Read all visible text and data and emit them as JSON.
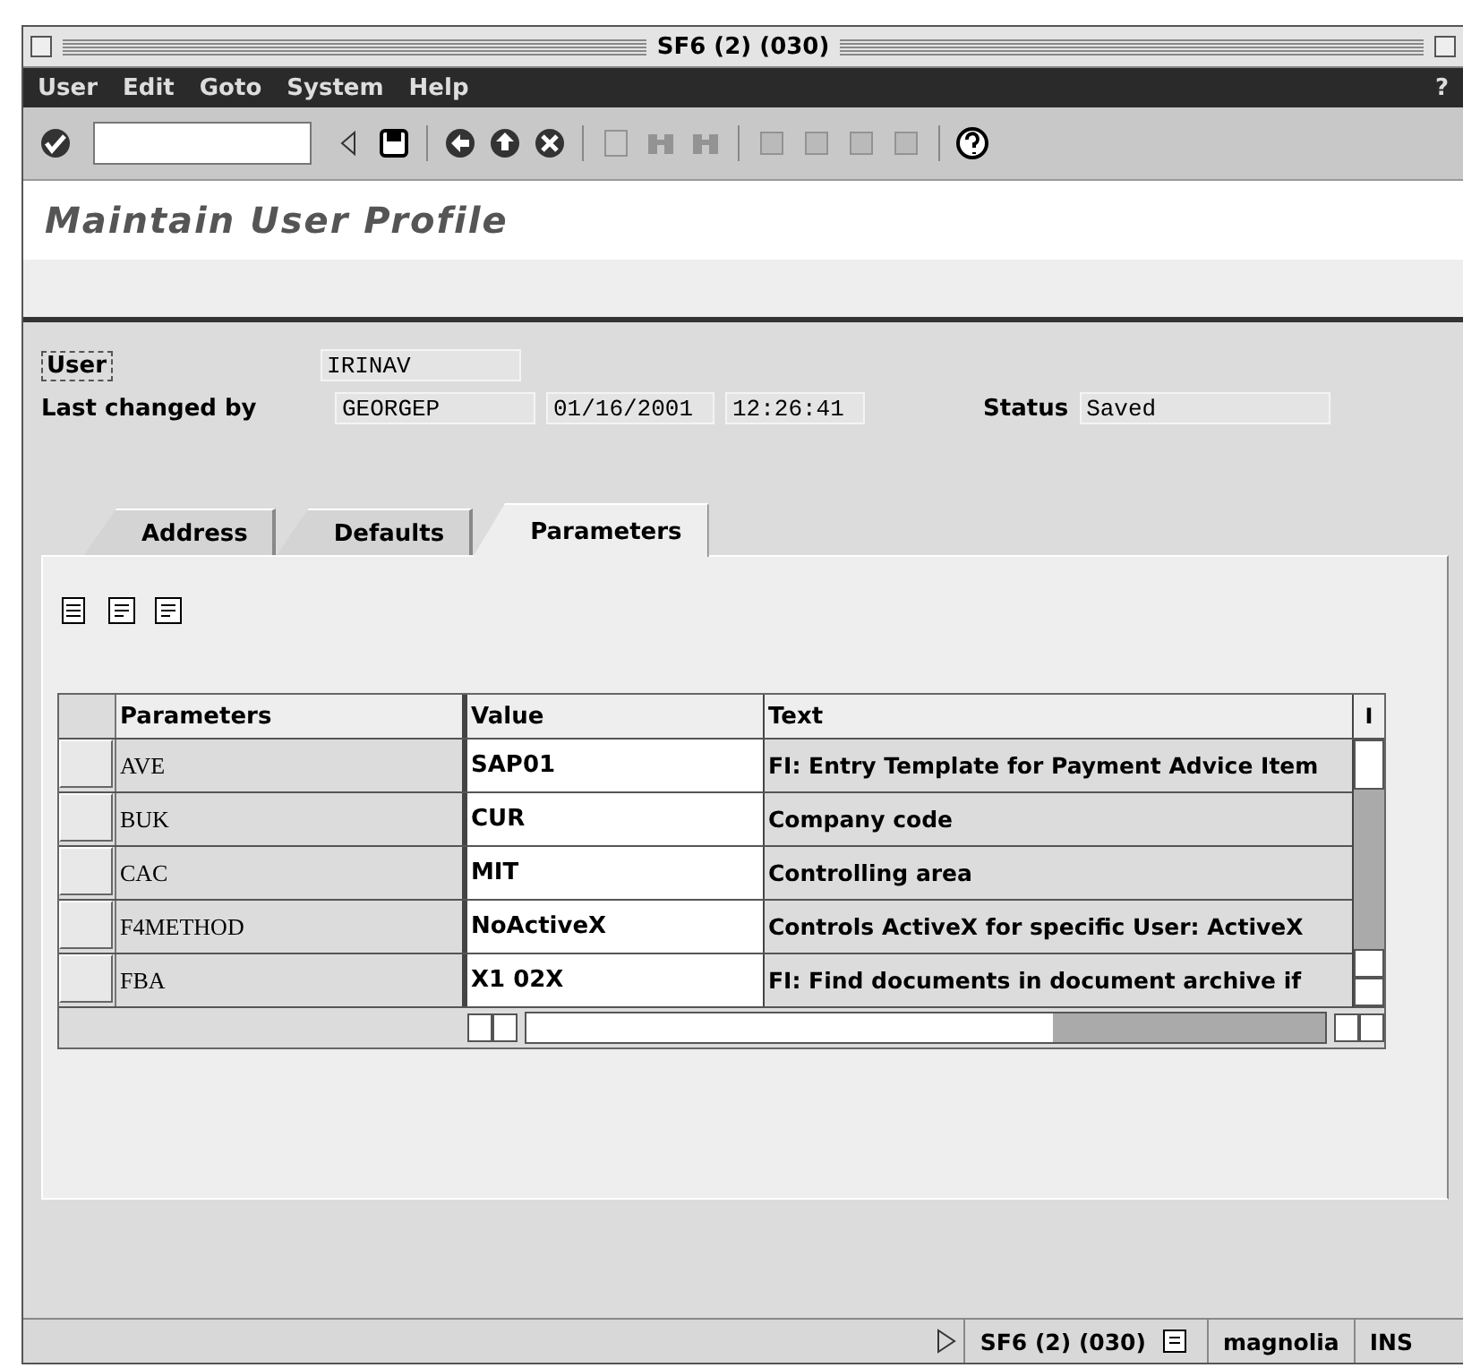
{
  "window": {
    "title": "SF6 (2) (030)"
  },
  "menu": [
    "User",
    "Edit",
    "Goto",
    "System",
    "Help"
  ],
  "menu_help": "?",
  "header": {
    "title": "Maintain User Profile"
  },
  "form": {
    "user_label": "User",
    "user_value": "IRINAV",
    "changed_label": "Last changed by",
    "changed_by": "GEORGEP",
    "changed_date": "01/16/2001",
    "changed_time": "12:26:41",
    "status_label": "Status",
    "status_value": "Saved"
  },
  "tabs": [
    {
      "label": "Address",
      "selected": false
    },
    {
      "label": "Defaults",
      "selected": false
    },
    {
      "label": "Parameters",
      "selected": true
    }
  ],
  "table": {
    "columns": [
      "Parameters",
      "Value",
      "Text",
      "I"
    ],
    "rows": [
      {
        "parameter": "AVE",
        "value": "SAP01",
        "text": "FI: Entry Template for Payment Advice Item"
      },
      {
        "parameter": "BUK",
        "value": "CUR",
        "text": "Company code"
      },
      {
        "parameter": "CAC",
        "value": "MIT",
        "text": "Controlling area"
      },
      {
        "parameter": "F4METHOD",
        "value": "NoActiveX",
        "text": "Controls ActiveX for specific User: ActiveX"
      },
      {
        "parameter": "FBA",
        "value": "X1 02X",
        "text": "FI: Find documents in document archive if"
      }
    ]
  },
  "status_bar": {
    "system": "SF6 (2) (030)",
    "server": "magnolia",
    "mode": "INS"
  }
}
